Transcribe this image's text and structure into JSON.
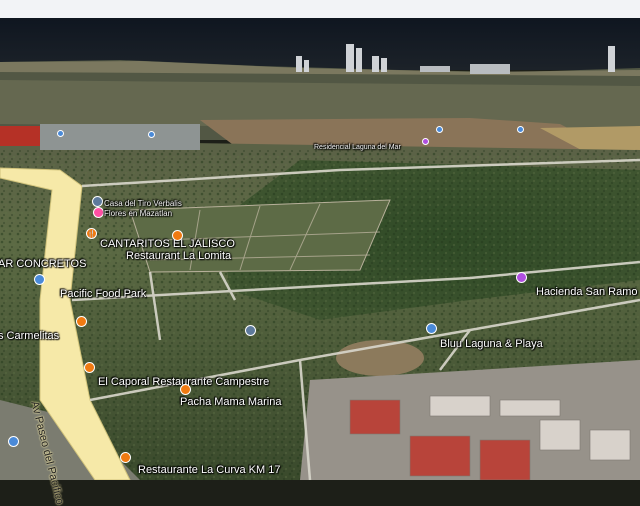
{
  "map": {
    "view": "3d-satellite",
    "colors": {
      "sky": "#f2f3f6",
      "ocean": "#141a22",
      "land": "#4d5a3c",
      "road": "#f6e9a8",
      "label": "#ffffff"
    }
  },
  "places": [
    {
      "id": "concretos",
      "label": "AR CONCRETOS",
      "icon": "none"
    },
    {
      "id": "pacific",
      "label": "Pacific Food Park",
      "icon": "place-icon"
    },
    {
      "id": "carmelitas",
      "label": "s Carmelitas",
      "icon": "restaurant-icon"
    },
    {
      "id": "cantaritos",
      "label": "CANTARITOS EL JALISCO",
      "icon": "restaurant-icon"
    },
    {
      "id": "lomita",
      "label": "Restaurant La Lomita",
      "icon": "none"
    },
    {
      "id": "caporal",
      "label": "El Caporal Restaurante Campestre",
      "icon": "restaurant-icon"
    },
    {
      "id": "pacha",
      "label": "Pacha Mama Marina",
      "icon": "restaurant-icon"
    },
    {
      "id": "curva",
      "label": "Restaurante La Curva KM 17",
      "icon": "restaurant-icon"
    },
    {
      "id": "hacienda",
      "label": "Hacienda San Ramo",
      "icon": "hotel-icon"
    },
    {
      "id": "bluu",
      "label": "Bluu Laguna & Playa",
      "icon": "place-icon"
    },
    {
      "id": "casacerro",
      "label": "Casa del Tiro Verbalis",
      "icon": "shop-icon"
    },
    {
      "id": "sanroma",
      "label": "Flores en Mazatlan",
      "icon": "none"
    },
    {
      "id": "farplace",
      "label": "Residencial Laguna del Mar",
      "icon": "none"
    }
  ],
  "roads": [
    {
      "id": "avenida",
      "label": "Av Paseo del Pacifico"
    }
  ]
}
